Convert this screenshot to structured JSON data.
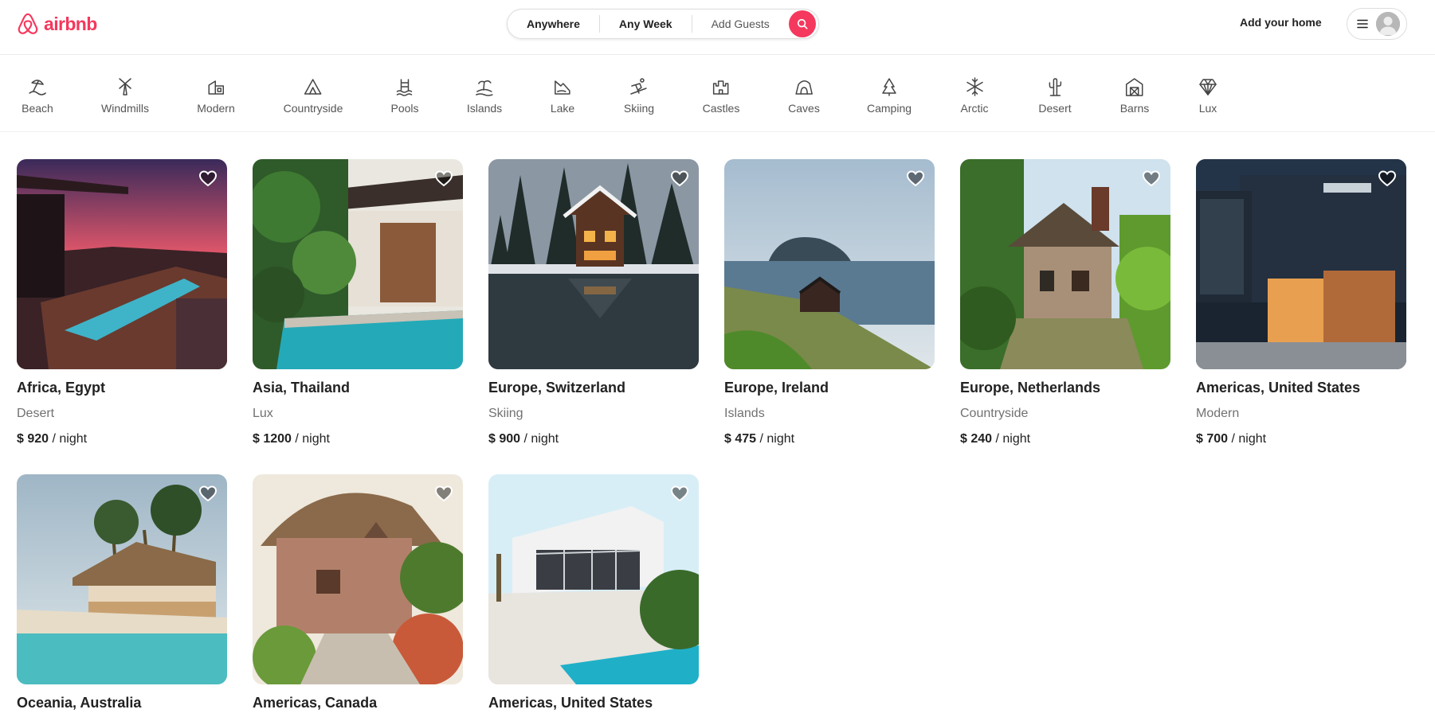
{
  "brand": {
    "name": "airbnb",
    "color": "#F5385D"
  },
  "search": {
    "location_label": "Anywhere",
    "dates_label": "Any Week",
    "guests_label": "Add Guests",
    "search_icon": "search-icon"
  },
  "header": {
    "host_label": "Add your home",
    "menu_icon": "hamburger-icon",
    "avatar_icon": "avatar-icon"
  },
  "categories": [
    {
      "label": "Beach",
      "icon": "beach-icon"
    },
    {
      "label": "Windmills",
      "icon": "windmill-icon"
    },
    {
      "label": "Modern",
      "icon": "modern-icon"
    },
    {
      "label": "Countryside",
      "icon": "countryside-icon"
    },
    {
      "label": "Pools",
      "icon": "pool-icon"
    },
    {
      "label": "Islands",
      "icon": "island-icon"
    },
    {
      "label": "Lake",
      "icon": "lake-icon"
    },
    {
      "label": "Skiing",
      "icon": "skiing-icon"
    },
    {
      "label": "Castles",
      "icon": "castle-icon"
    },
    {
      "label": "Caves",
      "icon": "cave-icon"
    },
    {
      "label": "Camping",
      "icon": "camping-icon"
    },
    {
      "label": "Arctic",
      "icon": "snowflake-icon"
    },
    {
      "label": "Desert",
      "icon": "cactus-icon"
    },
    {
      "label": "Barns",
      "icon": "barn-icon"
    },
    {
      "label": "Lux",
      "icon": "diamond-icon"
    }
  ],
  "listings": [
    {
      "title": "Africa, Egypt",
      "category": "Desert",
      "price": "$ 920",
      "unit": "/ night",
      "photo": "sunset-villa-pool"
    },
    {
      "title": "Asia, Thailand",
      "category": "Lux",
      "price": "$ 1200",
      "unit": "/ night",
      "photo": "tropical-pool-house"
    },
    {
      "title": "Europe, Switzerland",
      "category": "Skiing",
      "price": "$ 900",
      "unit": "/ night",
      "photo": "snowy-cabin-lake"
    },
    {
      "title": "Europe, Ireland",
      "category": "Islands",
      "price": "$ 475",
      "unit": "/ night",
      "photo": "coastal-cabin-island"
    },
    {
      "title": "Europe, Netherlands",
      "category": "Countryside",
      "price": "$ 240",
      "unit": "/ night",
      "photo": "thatched-cottage"
    },
    {
      "title": "Americas, United States",
      "category": "Modern",
      "price": "$ 700",
      "unit": "/ night",
      "photo": "dark-modern-house"
    },
    {
      "title": "Oceania, Australia",
      "category": "",
      "price": "",
      "unit": "",
      "photo": "beach-hut-palms"
    },
    {
      "title": "Americas, Canada",
      "category": "",
      "price": "",
      "unit": "",
      "photo": "storybook-cottage"
    },
    {
      "title": "Americas, United States",
      "category": "",
      "price": "",
      "unit": "",
      "photo": "white-villa-pool"
    }
  ]
}
